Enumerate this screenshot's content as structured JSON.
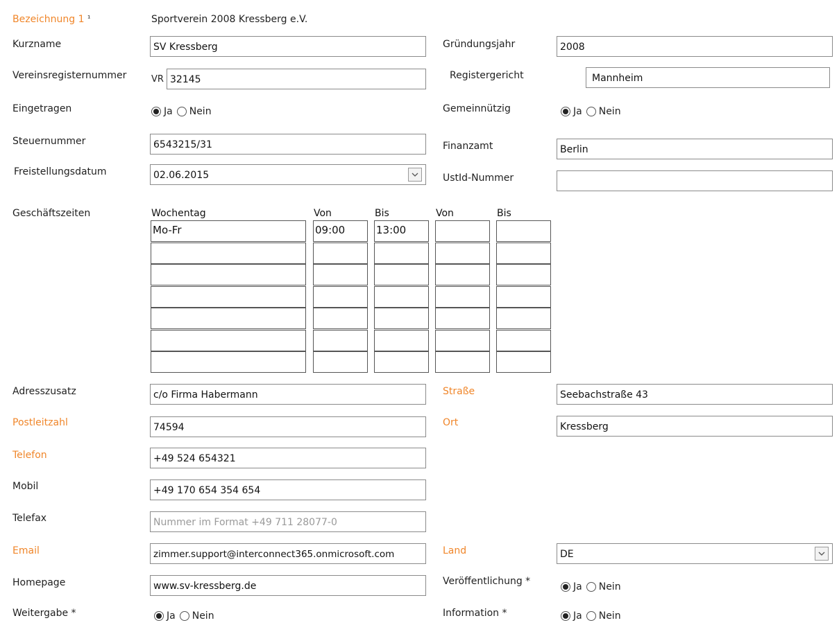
{
  "bezeichnung": {
    "label": "Bezeichnung 1",
    "note": "¹",
    "value": "Sportverein 2008 Kressberg e.V."
  },
  "kurzname": {
    "label": "Kurzname",
    "value": "SV Kressberg"
  },
  "gruendungsjahr": {
    "label": "Gründungsjahr",
    "value": "2008"
  },
  "vereinsregister": {
    "label": "Vereinsregisternummer",
    "prefix": "VR",
    "value": "32145"
  },
  "registergericht": {
    "label": "Registergericht",
    "value": "Mannheim"
  },
  "eingetragen": {
    "label": "Eingetragen",
    "options": [
      "Ja",
      "Nein"
    ],
    "selected": "Ja"
  },
  "gemeinnuetzig": {
    "label": "Gemeinnützig",
    "options": [
      "Ja",
      "Nein"
    ],
    "selected": "Ja"
  },
  "steuernummer": {
    "label": "Steuernummer",
    "value": "6543215/31"
  },
  "finanzamt": {
    "label": "Finanzamt",
    "value": "Berlin"
  },
  "freistellungsdatum": {
    "label": "Freistellungsdatum",
    "value": "02.06.2015"
  },
  "ustid": {
    "label": "UstId-Nummer",
    "value": ""
  },
  "geschaeftszeiten": {
    "label": "Geschäftszeiten",
    "headers": [
      "Wochentag",
      "Von",
      "Bis",
      "Von",
      "Bis"
    ],
    "rows": [
      [
        "Mo-Fr",
        "09:00",
        "13:00",
        "",
        ""
      ],
      [
        "",
        "",
        "",
        "",
        ""
      ],
      [
        "",
        "",
        "",
        "",
        ""
      ],
      [
        "",
        "",
        "",
        "",
        ""
      ],
      [
        "",
        "",
        "",
        "",
        ""
      ],
      [
        "",
        "",
        "",
        "",
        ""
      ],
      [
        "",
        "",
        "",
        "",
        ""
      ]
    ]
  },
  "adresszusatz": {
    "label": "Adresszusatz",
    "value": "c/o Firma Habermann"
  },
  "strasse": {
    "label": "Straße",
    "value": "Seebachstraße 43"
  },
  "postleitzahl": {
    "label": "Postleitzahl",
    "value": "74594"
  },
  "ort": {
    "label": "Ort",
    "value": "Kressberg"
  },
  "telefon": {
    "label": "Telefon",
    "value": "+49 524 654321"
  },
  "mobil": {
    "label": "Mobil",
    "value": "+49 170 654 354 654"
  },
  "telefax": {
    "label": "Telefax",
    "value": "",
    "placeholder": "Nummer im Format +49 711 28077-0"
  },
  "email": {
    "label": "Email",
    "value": "zimmer.support@interconnect365.onmicrosoft.com"
  },
  "land": {
    "label": "Land",
    "value": "DE"
  },
  "homepage": {
    "label": "Homepage",
    "value": "www.sv-kressberg.de"
  },
  "veroeffentlichung": {
    "label": "Veröffentlichung *",
    "options": [
      "Ja",
      "Nein"
    ],
    "selected": "Ja"
  },
  "weitergabe": {
    "label": "Weitergabe *",
    "options": [
      "Ja",
      "Nein"
    ],
    "selected": "Ja"
  },
  "information": {
    "label": "Information *",
    "options": [
      "Ja",
      "Nein"
    ],
    "selected": "Ja"
  },
  "colors": {
    "required_label": "#f0862a",
    "text": "#1f1f1f",
    "border": "#8a8a8a"
  },
  "icons": {
    "dropdown": "chevron-down-icon",
    "radio": "radio-icon"
  }
}
